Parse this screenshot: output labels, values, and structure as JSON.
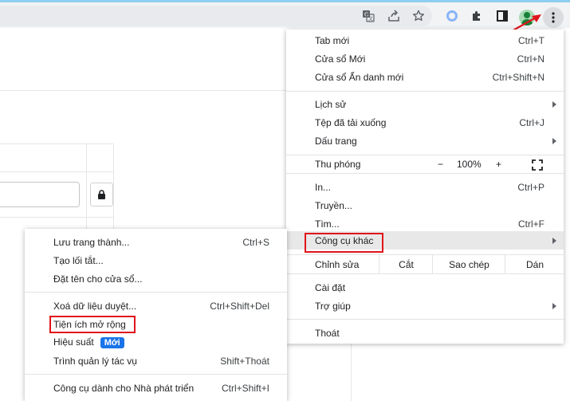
{
  "main_menu": {
    "new_tab": {
      "label": "Tab mới",
      "shortcut": "Ctrl+T"
    },
    "new_window": {
      "label": "Cửa sổ Mới",
      "shortcut": "Ctrl+N"
    },
    "incognito": {
      "label": "Cửa sổ Ẩn danh mới",
      "shortcut": "Ctrl+Shift+N"
    },
    "history": {
      "label": "Lịch sử"
    },
    "downloads": {
      "label": "Tệp đã tải xuống",
      "shortcut": "Ctrl+J"
    },
    "bookmarks": {
      "label": "Dấu trang"
    },
    "zoom": {
      "label": "Thu phóng",
      "minus": "−",
      "value": "100%",
      "plus": "+"
    },
    "print": {
      "label": "In...",
      "shortcut": "Ctrl+P"
    },
    "cast": {
      "label": "Truyền..."
    },
    "find": {
      "label": "Tìm...",
      "shortcut": "Ctrl+F"
    },
    "more_tools": {
      "label": "Công cụ khác"
    },
    "edit": {
      "label": "Chỉnh sửa",
      "cut": "Cắt",
      "copy": "Sao chép",
      "paste": "Dán"
    },
    "settings": {
      "label": "Cài đặt"
    },
    "help": {
      "label": "Trợ giúp"
    },
    "exit": {
      "label": "Thoát"
    }
  },
  "sub_menu": {
    "save_page": {
      "label": "Lưu trang thành...",
      "shortcut": "Ctrl+S"
    },
    "create_shortcut": {
      "label": "Tạo lối tắt..."
    },
    "name_window": {
      "label": "Đặt tên cho cửa sổ..."
    },
    "clear_data": {
      "label": "Xoá dữ liệu duyệt...",
      "shortcut": "Ctrl+Shift+Del"
    },
    "extensions": {
      "label": "Tiện ích mở rộng"
    },
    "performance": {
      "label": "Hiệu suất",
      "badge": "Mới"
    },
    "task_manager": {
      "label": "Trình quản lý tác vụ",
      "shortcut": "Shift+Thoát"
    },
    "dev_tools": {
      "label": "Công cụ dành cho Nhà phát triển",
      "shortcut": "Ctrl+Shift+I"
    }
  },
  "colors": {
    "highlight_box": "#e0141b",
    "badge": "#1a73e8",
    "accent_line": "#8ecff0"
  }
}
